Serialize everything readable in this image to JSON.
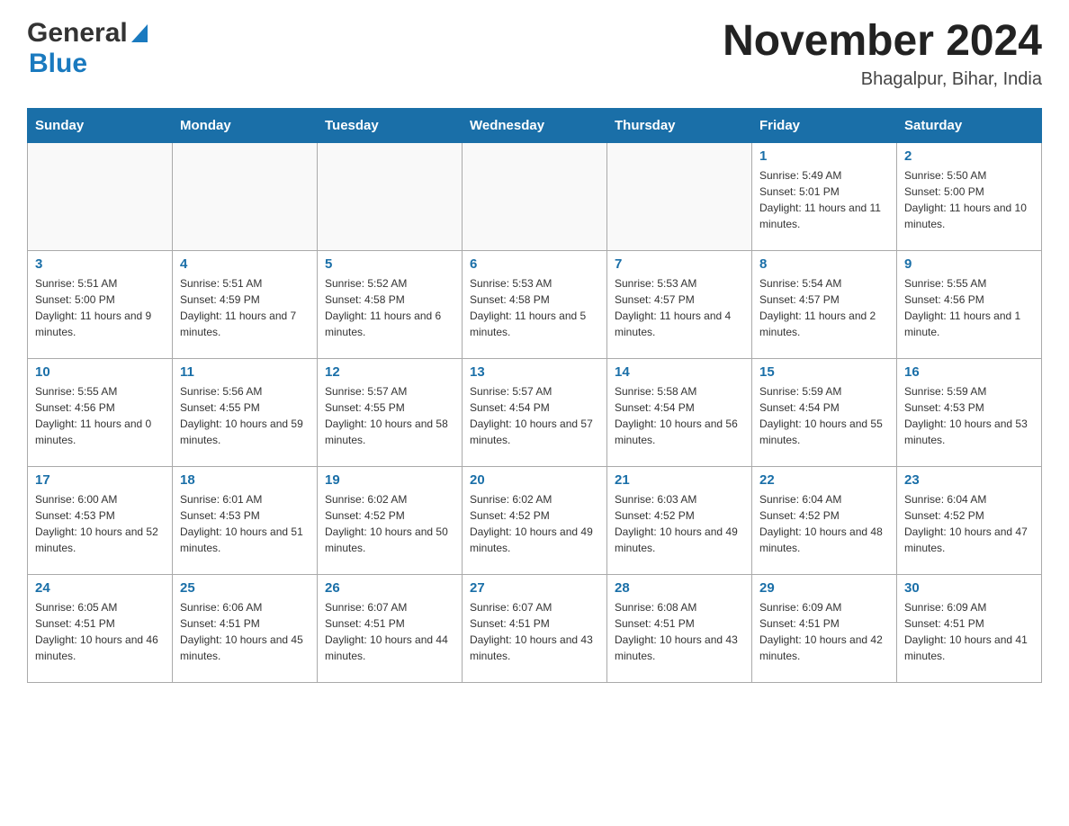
{
  "header": {
    "logo_general": "General",
    "logo_blue": "Blue",
    "month_title": "November 2024",
    "subtitle": "Bhagalpur, Bihar, India"
  },
  "days_of_week": [
    "Sunday",
    "Monday",
    "Tuesday",
    "Wednesday",
    "Thursday",
    "Friday",
    "Saturday"
  ],
  "weeks": [
    [
      {
        "day": "",
        "sunrise": "",
        "sunset": "",
        "daylight": ""
      },
      {
        "day": "",
        "sunrise": "",
        "sunset": "",
        "daylight": ""
      },
      {
        "day": "",
        "sunrise": "",
        "sunset": "",
        "daylight": ""
      },
      {
        "day": "",
        "sunrise": "",
        "sunset": "",
        "daylight": ""
      },
      {
        "day": "",
        "sunrise": "",
        "sunset": "",
        "daylight": ""
      },
      {
        "day": "1",
        "sunrise": "Sunrise: 5:49 AM",
        "sunset": "Sunset: 5:01 PM",
        "daylight": "Daylight: 11 hours and 11 minutes."
      },
      {
        "day": "2",
        "sunrise": "Sunrise: 5:50 AM",
        "sunset": "Sunset: 5:00 PM",
        "daylight": "Daylight: 11 hours and 10 minutes."
      }
    ],
    [
      {
        "day": "3",
        "sunrise": "Sunrise: 5:51 AM",
        "sunset": "Sunset: 5:00 PM",
        "daylight": "Daylight: 11 hours and 9 minutes."
      },
      {
        "day": "4",
        "sunrise": "Sunrise: 5:51 AM",
        "sunset": "Sunset: 4:59 PM",
        "daylight": "Daylight: 11 hours and 7 minutes."
      },
      {
        "day": "5",
        "sunrise": "Sunrise: 5:52 AM",
        "sunset": "Sunset: 4:58 PM",
        "daylight": "Daylight: 11 hours and 6 minutes."
      },
      {
        "day": "6",
        "sunrise": "Sunrise: 5:53 AM",
        "sunset": "Sunset: 4:58 PM",
        "daylight": "Daylight: 11 hours and 5 minutes."
      },
      {
        "day": "7",
        "sunrise": "Sunrise: 5:53 AM",
        "sunset": "Sunset: 4:57 PM",
        "daylight": "Daylight: 11 hours and 4 minutes."
      },
      {
        "day": "8",
        "sunrise": "Sunrise: 5:54 AM",
        "sunset": "Sunset: 4:57 PM",
        "daylight": "Daylight: 11 hours and 2 minutes."
      },
      {
        "day": "9",
        "sunrise": "Sunrise: 5:55 AM",
        "sunset": "Sunset: 4:56 PM",
        "daylight": "Daylight: 11 hours and 1 minute."
      }
    ],
    [
      {
        "day": "10",
        "sunrise": "Sunrise: 5:55 AM",
        "sunset": "Sunset: 4:56 PM",
        "daylight": "Daylight: 11 hours and 0 minutes."
      },
      {
        "day": "11",
        "sunrise": "Sunrise: 5:56 AM",
        "sunset": "Sunset: 4:55 PM",
        "daylight": "Daylight: 10 hours and 59 minutes."
      },
      {
        "day": "12",
        "sunrise": "Sunrise: 5:57 AM",
        "sunset": "Sunset: 4:55 PM",
        "daylight": "Daylight: 10 hours and 58 minutes."
      },
      {
        "day": "13",
        "sunrise": "Sunrise: 5:57 AM",
        "sunset": "Sunset: 4:54 PM",
        "daylight": "Daylight: 10 hours and 57 minutes."
      },
      {
        "day": "14",
        "sunrise": "Sunrise: 5:58 AM",
        "sunset": "Sunset: 4:54 PM",
        "daylight": "Daylight: 10 hours and 56 minutes."
      },
      {
        "day": "15",
        "sunrise": "Sunrise: 5:59 AM",
        "sunset": "Sunset: 4:54 PM",
        "daylight": "Daylight: 10 hours and 55 minutes."
      },
      {
        "day": "16",
        "sunrise": "Sunrise: 5:59 AM",
        "sunset": "Sunset: 4:53 PM",
        "daylight": "Daylight: 10 hours and 53 minutes."
      }
    ],
    [
      {
        "day": "17",
        "sunrise": "Sunrise: 6:00 AM",
        "sunset": "Sunset: 4:53 PM",
        "daylight": "Daylight: 10 hours and 52 minutes."
      },
      {
        "day": "18",
        "sunrise": "Sunrise: 6:01 AM",
        "sunset": "Sunset: 4:53 PM",
        "daylight": "Daylight: 10 hours and 51 minutes."
      },
      {
        "day": "19",
        "sunrise": "Sunrise: 6:02 AM",
        "sunset": "Sunset: 4:52 PM",
        "daylight": "Daylight: 10 hours and 50 minutes."
      },
      {
        "day": "20",
        "sunrise": "Sunrise: 6:02 AM",
        "sunset": "Sunset: 4:52 PM",
        "daylight": "Daylight: 10 hours and 49 minutes."
      },
      {
        "day": "21",
        "sunrise": "Sunrise: 6:03 AM",
        "sunset": "Sunset: 4:52 PM",
        "daylight": "Daylight: 10 hours and 49 minutes."
      },
      {
        "day": "22",
        "sunrise": "Sunrise: 6:04 AM",
        "sunset": "Sunset: 4:52 PM",
        "daylight": "Daylight: 10 hours and 48 minutes."
      },
      {
        "day": "23",
        "sunrise": "Sunrise: 6:04 AM",
        "sunset": "Sunset: 4:52 PM",
        "daylight": "Daylight: 10 hours and 47 minutes."
      }
    ],
    [
      {
        "day": "24",
        "sunrise": "Sunrise: 6:05 AM",
        "sunset": "Sunset: 4:51 PM",
        "daylight": "Daylight: 10 hours and 46 minutes."
      },
      {
        "day": "25",
        "sunrise": "Sunrise: 6:06 AM",
        "sunset": "Sunset: 4:51 PM",
        "daylight": "Daylight: 10 hours and 45 minutes."
      },
      {
        "day": "26",
        "sunrise": "Sunrise: 6:07 AM",
        "sunset": "Sunset: 4:51 PM",
        "daylight": "Daylight: 10 hours and 44 minutes."
      },
      {
        "day": "27",
        "sunrise": "Sunrise: 6:07 AM",
        "sunset": "Sunset: 4:51 PM",
        "daylight": "Daylight: 10 hours and 43 minutes."
      },
      {
        "day": "28",
        "sunrise": "Sunrise: 6:08 AM",
        "sunset": "Sunset: 4:51 PM",
        "daylight": "Daylight: 10 hours and 43 minutes."
      },
      {
        "day": "29",
        "sunrise": "Sunrise: 6:09 AM",
        "sunset": "Sunset: 4:51 PM",
        "daylight": "Daylight: 10 hours and 42 minutes."
      },
      {
        "day": "30",
        "sunrise": "Sunrise: 6:09 AM",
        "sunset": "Sunset: 4:51 PM",
        "daylight": "Daylight: 10 hours and 41 minutes."
      }
    ]
  ]
}
